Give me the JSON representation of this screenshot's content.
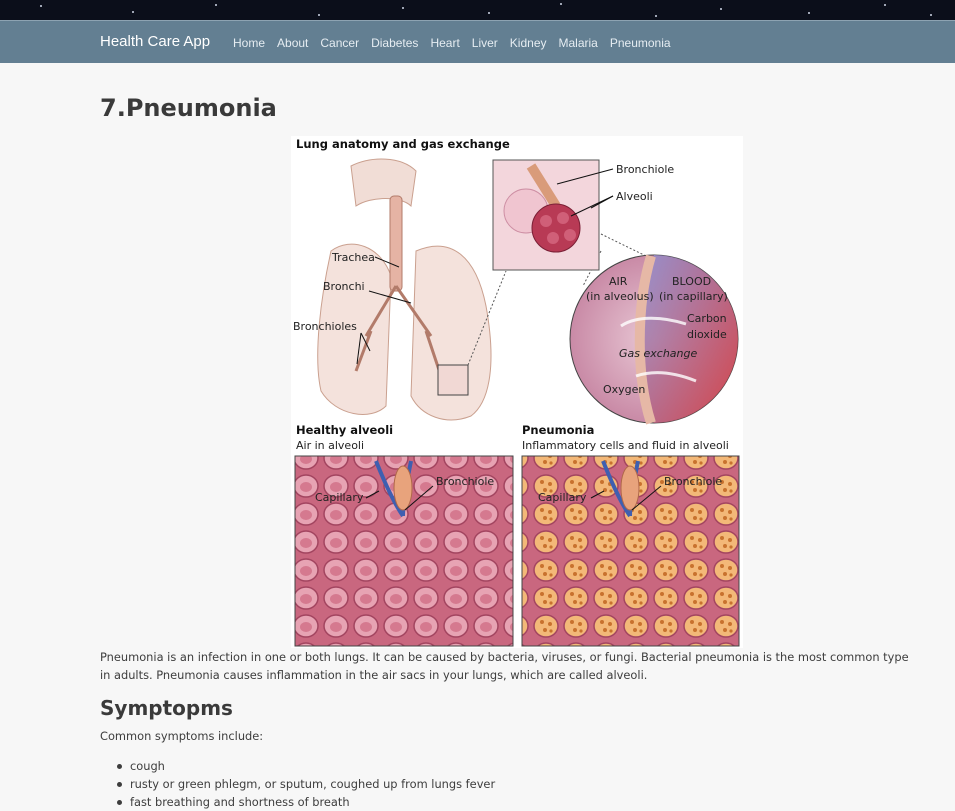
{
  "navbar": {
    "brand": "Health Care App",
    "links": [
      "Home",
      "About",
      "Cancer",
      "Diabetes",
      "Heart",
      "Liver",
      "Kidney",
      "Malaria",
      "Pneumonia"
    ]
  },
  "page": {
    "title": "7.Pneumonia",
    "description": "Pneumonia is an infection in one or both lungs. It can be caused by bacteria, viruses, or fungi. Bacterial pneumonia is the most common type in adults. Pneumonia causes inflammation in the air sacs in your lungs, which are called alveoli.",
    "symptoms_heading": "Symptopms",
    "symptoms_intro": "Common symptoms include:",
    "symptoms": [
      "cough",
      "rusty or green phlegm, or sputum, coughed up from lungs fever",
      "fast breathing and shortness of breath"
    ]
  },
  "figure": {
    "title": "Lung anatomy and gas exchange",
    "labels": {
      "trachea": "Trachea",
      "bronchi": "Bronchi",
      "bronchioles": "Bronchioles",
      "bronchiole": "Bronchiole",
      "alveoli": "Alveoli",
      "air": "AIR",
      "air_sub": "(in alveolus)",
      "blood": "BLOOD",
      "blood_sub": "(in capillary)",
      "carbon": "Carbon",
      "dioxide": "dioxide",
      "gas_exchange": "Gas exchange",
      "oxygen": "Oxygen",
      "capillary": "Capillary"
    },
    "healthy": {
      "title": "Healthy alveoli",
      "subtitle": "Air in alveoli"
    },
    "pneumonia": {
      "title": "Pneumonia",
      "subtitle": "Inflammatory cells and fluid in alveoli"
    }
  }
}
